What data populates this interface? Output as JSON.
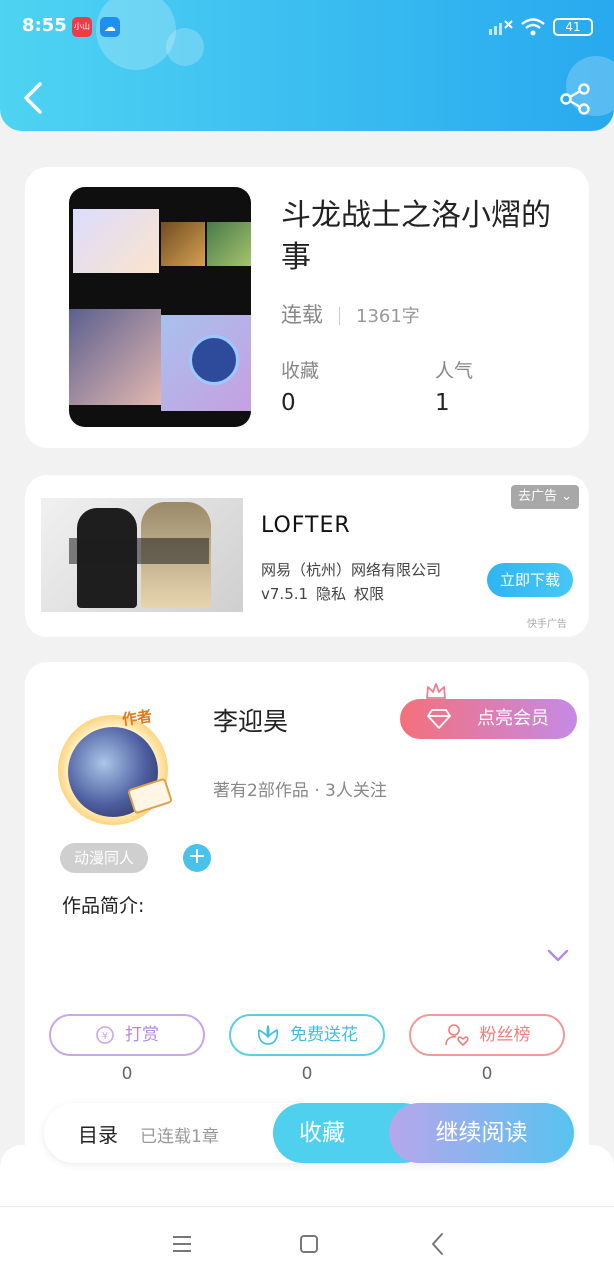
{
  "status_bar": {
    "time": "8:55",
    "app1_label": "小山",
    "app2_label": "☁",
    "battery": "41"
  },
  "book": {
    "title": "斗龙战士之洛小熠的事",
    "status": "连载",
    "word_count": "1361字",
    "favorites_label": "收藏",
    "favorites_value": "0",
    "popularity_label": "人气",
    "popularity_value": "1"
  },
  "ad": {
    "close_label": "去广告",
    "title": "LOFTER",
    "company": "网易（杭州）网络有限公司",
    "version": "v7.5.1",
    "privacy": "隐私",
    "permissions": "权限",
    "download_label": "立即下载",
    "source": "快手广告"
  },
  "author": {
    "badge": "作者",
    "name": "李迎昊",
    "vip_label": "点亮会员",
    "stats": "著有2部作品 · 3人关注",
    "tag": "动漫同人",
    "add_tag": "+",
    "intro_label": "作品简介:"
  },
  "actions": [
    {
      "label": "打赏",
      "count": "0"
    },
    {
      "label": "免费送花",
      "count": "0"
    },
    {
      "label": "粉丝榜",
      "count": "0"
    }
  ],
  "bottom_bar": {
    "toc_label": "目录",
    "toc_status": "已连载1章",
    "favorite_label": "收藏",
    "read_label": "继续阅读"
  },
  "colors": {
    "header_start": "#4fd3f2",
    "header_end": "#28a9ef",
    "accent_blue": "#4fd0ef",
    "vip_start": "#f4707a",
    "vip_end": "#c58ae6"
  },
  "icons": [
    "back-arrow-icon",
    "share-icon",
    "signal-icon",
    "wifi-icon",
    "battery-icon",
    "crown-icon",
    "diamond-icon",
    "chevron-down-icon",
    "yen-icon",
    "flower-icon",
    "user-heart-icon",
    "menu-icon",
    "home-icon",
    "nav-back-icon"
  ]
}
